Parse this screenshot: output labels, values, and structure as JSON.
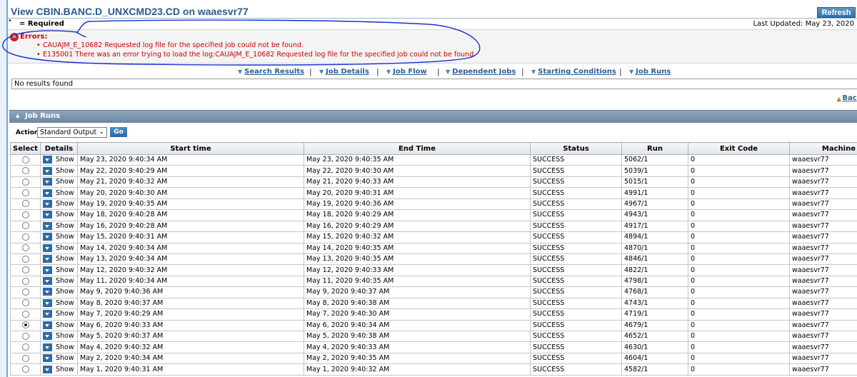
{
  "window": {
    "title": "View CBIN.BANC.D_UNXCMD23.CD on waaesvr77",
    "refresh_label": "Refresh"
  },
  "required_note": "= Required",
  "last_updated": "Last Updated: May 23, 2020",
  "errors": {
    "title": "Errors:",
    "items": [
      "CAUAJM_E_10682 Requested log file for the specified job could not be found.",
      "E135001 There was an error trying to load the log:CAUAJM_E_10682 Requested log file for the specified job could not be found."
    ]
  },
  "tabs": [
    {
      "label": "Search Results"
    },
    {
      "label": "Job Details"
    },
    {
      "label": "Job Flow"
    },
    {
      "label": "Dependent Jobs"
    },
    {
      "label": "Starting Conditions"
    },
    {
      "label": "Job Runs"
    }
  ],
  "no_results_text": "No results found",
  "back_link": "Bac",
  "section": {
    "title": "Job Runs"
  },
  "action": {
    "label": "Action",
    "selected": "Standard Output",
    "go_label": "Go"
  },
  "table": {
    "headers": [
      "Select",
      "Details",
      "Start time",
      "End Time",
      "Status",
      "Run",
      "Exit Code",
      "Machine"
    ],
    "details_label": "Show",
    "selected_row_index": 15,
    "rows": [
      {
        "start": "May 23, 2020 9:40:34 AM",
        "end": "May 23, 2020 9:40:35 AM",
        "status": "SUCCESS",
        "run": "5062/1",
        "exit": "0",
        "machine": "waaesvr77"
      },
      {
        "start": "May 22, 2020 9:40:29 AM",
        "end": "May 22, 2020 9:40:30 AM",
        "status": "SUCCESS",
        "run": "5039/1",
        "exit": "0",
        "machine": "waaesvr77"
      },
      {
        "start": "May 21, 2020 9:40:32 AM",
        "end": "May 21, 2020 9:40:33 AM",
        "status": "SUCCESS",
        "run": "5015/1",
        "exit": "0",
        "machine": "waaesvr77"
      },
      {
        "start": "May 20, 2020 9:40:30 AM",
        "end": "May 20, 2020 9:40:31 AM",
        "status": "SUCCESS",
        "run": "4991/1",
        "exit": "0",
        "machine": "waaesvr77"
      },
      {
        "start": "May 19, 2020 9:40:35 AM",
        "end": "May 19, 2020 9:40:36 AM",
        "status": "SUCCESS",
        "run": "4967/1",
        "exit": "0",
        "machine": "waaesvr77"
      },
      {
        "start": "May 18, 2020 9:40:28 AM",
        "end": "May 18, 2020 9:40:29 AM",
        "status": "SUCCESS",
        "run": "4943/1",
        "exit": "0",
        "machine": "waaesvr77"
      },
      {
        "start": "May 16, 2020 9:40:28 AM",
        "end": "May 16, 2020 9:40:29 AM",
        "status": "SUCCESS",
        "run": "4917/1",
        "exit": "0",
        "machine": "waaesvr77"
      },
      {
        "start": "May 15, 2020 9:40:31 AM",
        "end": "May 15, 2020 9:40:32 AM",
        "status": "SUCCESS",
        "run": "4894/1",
        "exit": "0",
        "machine": "waaesvr77"
      },
      {
        "start": "May 14, 2020 9:40:34 AM",
        "end": "May 14, 2020 9:40:35 AM",
        "status": "SUCCESS",
        "run": "4870/1",
        "exit": "0",
        "machine": "waaesvr77"
      },
      {
        "start": "May 13, 2020 9:40:34 AM",
        "end": "May 13, 2020 9:40:35 AM",
        "status": "SUCCESS",
        "run": "4846/1",
        "exit": "0",
        "machine": "waaesvr77"
      },
      {
        "start": "May 12, 2020 9:40:32 AM",
        "end": "May 12, 2020 9:40:33 AM",
        "status": "SUCCESS",
        "run": "4822/1",
        "exit": "0",
        "machine": "waaesvr77"
      },
      {
        "start": "May 11, 2020 9:40:34 AM",
        "end": "May 11, 2020 9:40:35 AM",
        "status": "SUCCESS",
        "run": "4798/1",
        "exit": "0",
        "machine": "waaesvr77"
      },
      {
        "start": "May 9, 2020 9:40:36 AM",
        "end": "May 9, 2020 9:40:37 AM",
        "status": "SUCCESS",
        "run": "4768/1",
        "exit": "0",
        "machine": "waaesvr77"
      },
      {
        "start": "May 8, 2020 9:40:37 AM",
        "end": "May 8, 2020 9:40:38 AM",
        "status": "SUCCESS",
        "run": "4743/1",
        "exit": "0",
        "machine": "waaesvr77"
      },
      {
        "start": "May 7, 2020 9:40:29 AM",
        "end": "May 7, 2020 9:40:30 AM",
        "status": "SUCCESS",
        "run": "4719/1",
        "exit": "0",
        "machine": "waaesvr77"
      },
      {
        "start": "May 6, 2020 9:40:33 AM",
        "end": "May 6, 2020 9:40:34 AM",
        "status": "SUCCESS",
        "run": "4679/1",
        "exit": "0",
        "machine": "waaesvr77"
      },
      {
        "start": "May 5, 2020 9:40:37 AM",
        "end": "May 5, 2020 9:40:38 AM",
        "status": "SUCCESS",
        "run": "4652/1",
        "exit": "0",
        "machine": "waaesvr77"
      },
      {
        "start": "May 4, 2020 9:40:32 AM",
        "end": "May 4, 2020 9:40:33 AM",
        "status": "SUCCESS",
        "run": "4630/1",
        "exit": "0",
        "machine": "waaesvr77"
      },
      {
        "start": "May 2, 2020 9:40:34 AM",
        "end": "May 2, 2020 9:40:35 AM",
        "status": "SUCCESS",
        "run": "4604/1",
        "exit": "0",
        "machine": "waaesvr77"
      },
      {
        "start": "May 1, 2020 9:40:31 AM",
        "end": "May 1, 2020 9:40:32 AM",
        "status": "SUCCESS",
        "run": "4582/1",
        "exit": "0",
        "machine": "waaesvr77"
      }
    ]
  },
  "colors": {
    "title": "#2b5a8c",
    "error": "#cc0000",
    "annotation": "#1a2fd1",
    "section_header": "#7790ab",
    "link": "#2f5f93"
  },
  "icons": [
    "error-icon",
    "chevron-down-icon",
    "chevron-up-icon",
    "details-dropdown-icon",
    "radio-icon"
  ]
}
